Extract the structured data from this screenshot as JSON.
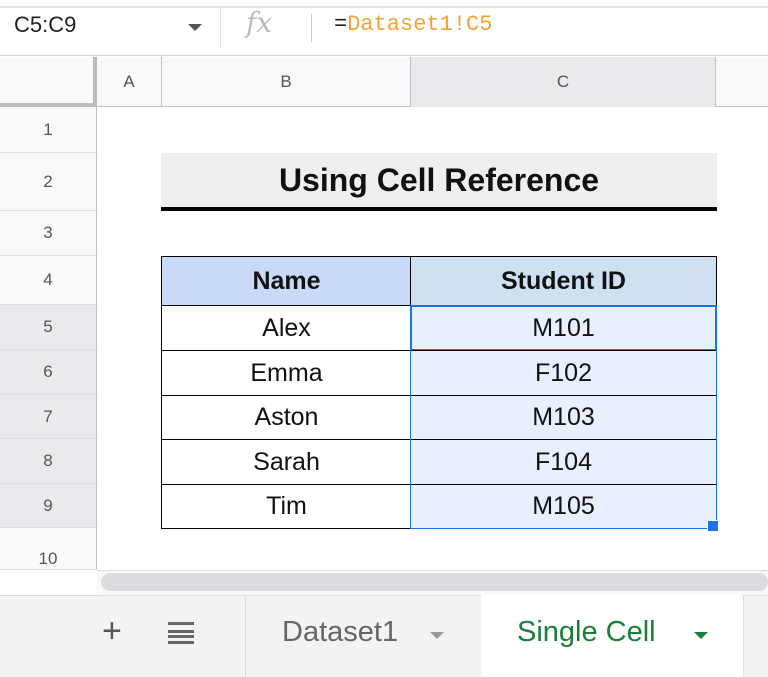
{
  "formula_bar": {
    "name_box": "C5:C9",
    "fx": "fx",
    "formula_eq": "=",
    "formula_ref": "Dataset1!C5"
  },
  "columns": [
    "A",
    "B",
    "C"
  ],
  "rows": [
    "1",
    "2",
    "3",
    "4",
    "5",
    "6",
    "7",
    "8",
    "9",
    "10"
  ],
  "title": "Using Cell Reference",
  "table": {
    "headers": [
      "Name",
      "Student ID"
    ],
    "rows": [
      [
        "Alex",
        "M101"
      ],
      [
        "Emma",
        "F102"
      ],
      [
        "Aston",
        "M103"
      ],
      [
        "Sarah",
        "F104"
      ],
      [
        "Tim",
        "M105"
      ]
    ]
  },
  "tabs": {
    "add": "+",
    "items": [
      {
        "label": "Dataset1"
      },
      {
        "label": "Single Cell",
        "active": true
      }
    ]
  },
  "colors": {
    "accent": "#1a73e8",
    "active_tab": "#188038",
    "formula_ref": "#f4a233",
    "header_fill": "#c9daf8",
    "selection_fill": "#e8f0fe"
  }
}
